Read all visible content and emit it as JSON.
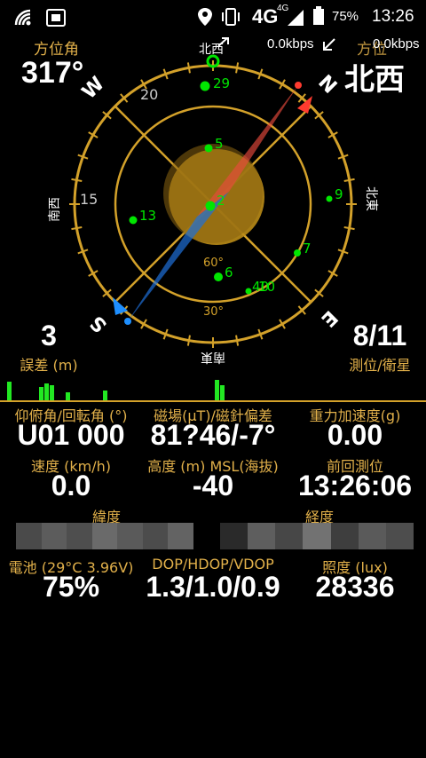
{
  "status_bar": {
    "network": "4G",
    "network_small": "4G",
    "battery_percent": "75%",
    "time": "13:26",
    "icons": [
      "wifi-signal-icon",
      "sim-card-icon",
      "location-icon",
      "vibrate-icon",
      "signal-icon",
      "battery-icon"
    ]
  },
  "compass": {
    "heading_label": "方位角",
    "heading_value": "317°",
    "direction_text": "北西",
    "speed_rate_1": "0.0kbps",
    "speed_rate_2": "0.0kbps",
    "overlap_label": "方位",
    "ring_labels": {
      "north_kanji": "北西",
      "east_kanji": "北東",
      "south_kanji": "南東",
      "west_kanji": "南西",
      "N": "N",
      "E": "E",
      "S": "S",
      "W": "W"
    },
    "elevation_labels": [
      "20",
      "15",
      "60°",
      "30°"
    ],
    "satellites": [
      {
        "id": "29",
        "az": 345,
        "el": 8
      },
      {
        "id": "5",
        "az": 0,
        "el": 45
      },
      {
        "id": "2",
        "az": 0,
        "el": 90
      },
      {
        "id": "13",
        "az": 268,
        "el": 50
      },
      {
        "id": "9",
        "az": 92,
        "el": 35
      },
      {
        "id": "7",
        "az": 130,
        "el": 35
      },
      {
        "id": "6",
        "az": 180,
        "el": 55
      },
      {
        "id": "40",
        "az": 155,
        "el": 45
      },
      {
        "id": "10",
        "az": 155,
        "el": 42
      }
    ],
    "colors": {
      "ring": "#d3a12a",
      "satellite": "#00e600",
      "needle_north": "#e84a3c",
      "needle_south": "#1e6fd9",
      "sun": "#b98b17"
    }
  },
  "stats_top": {
    "accuracy_value": "3",
    "accuracy_label": "誤差 (m)",
    "fix_value": "8/11",
    "fix_label": "測位/衛星"
  },
  "signal_bars": [
    22,
    0,
    0,
    0,
    0,
    0,
    16,
    20,
    18,
    0,
    0,
    10,
    0,
    0,
    0,
    0,
    0,
    0,
    12,
    0,
    0,
    0,
    0,
    0,
    0,
    0,
    0,
    0,
    0,
    0,
    0,
    0,
    0,
    0,
    0,
    0,
    0,
    0,
    0,
    24,
    18,
    0,
    0,
    0,
    0,
    0,
    0,
    0,
    0,
    0,
    0,
    0,
    0,
    0,
    0,
    0,
    0,
    0,
    0,
    0,
    0,
    0,
    0,
    0,
    0,
    0,
    0,
    0,
    0,
    0,
    0,
    0,
    0,
    0,
    0,
    0,
    0,
    0,
    0,
    0
  ],
  "stats": {
    "pitch_label": "仰俯角/回転角 (°)",
    "pitch_value": "U01 000",
    "magnetic_label": "磁場(μT)/磁針偏差",
    "magnetic_value": "81?46/-7°",
    "gravity_label": "重力加速度(g)",
    "gravity_value": "0.00",
    "speed_label": "速度 (km/h)",
    "speed_value": "0.0",
    "altitude_label": "高度 (m) MSL(海抜)",
    "altitude_value": "-40",
    "last_fix_label": "前回測位",
    "last_fix_value": "13:26:06",
    "latitude_label": "緯度",
    "longitude_label": "経度",
    "battery_label": "電池 (29°C 3.96V)",
    "battery_value": "75%",
    "dop_label": "DOP/HDOP/VDOP",
    "dop_value": "1.3/1.0/0.9",
    "lux_label": "照度 (lux)",
    "lux_value": "28336"
  },
  "latitude_cells": [
    "#4a4a4a",
    "#5c5c5c",
    "#4e4e4e",
    "#6a6a6a",
    "#5a5a5a",
    "#4c4c4c",
    "#636363"
  ],
  "longitude_cells": [
    "#2a2a2a",
    "#5e5e5e",
    "#474747",
    "#727272",
    "#3e3e3e",
    "#5a5a5a",
    "#4d4d4d"
  ]
}
